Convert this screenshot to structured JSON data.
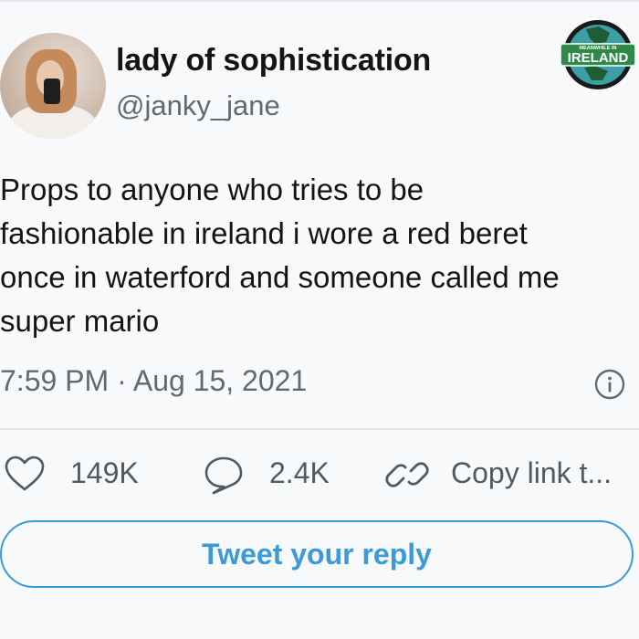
{
  "user": {
    "display_name": "lady of sophistication",
    "handle": "@janky_jane"
  },
  "logo": {
    "text_top": "MEANWHILE IN",
    "text_main": "IRELAND",
    "colors": {
      "ring": "#1a1a1a",
      "banner": "#2f8a4a",
      "globe": "#3aa0a6"
    }
  },
  "tweet": {
    "lines": [
      "Props to anyone who tries to be",
      "fashionable in ireland i wore a red beret",
      "once in waterford and someone called me",
      "super mario"
    ],
    "timestamp": "7:59 PM · Aug 15, 2021"
  },
  "actions": {
    "likes": "149K",
    "replies": "2.4K",
    "copy_link": "Copy link t..."
  },
  "reply_button": {
    "label": "Tweet your reply"
  },
  "colors": {
    "accent": "#3a9bd8",
    "muted": "#5f6a73",
    "background": "#f7f9fb"
  },
  "icons": [
    "heart-icon",
    "comment-icon",
    "link-icon",
    "info-icon"
  ]
}
